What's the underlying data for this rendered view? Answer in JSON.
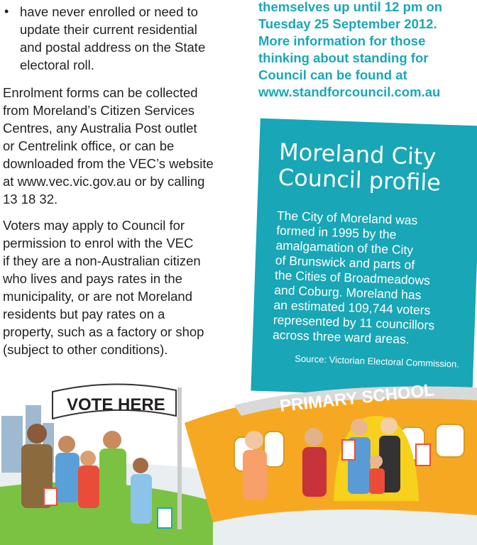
{
  "left": {
    "bullet_lines": [
      "have never enrolled or need to",
      "update their current residential",
      "and postal address on the State",
      "electoral roll."
    ],
    "para1_lines": [
      "Enrolment forms can be collected",
      "from Moreland’s Citizen Services",
      "Centres, any Australia Post outlet",
      "or Centrelink office, or can be",
      "downloaded from the VEC’s website",
      "at www.vec.vic.gov.au or by calling",
      "13 18 32."
    ],
    "para2_lines": [
      "Voters may apply to Council for",
      "permission to enrol with the VEC",
      "if they are a non-Australian citizen",
      "who lives and pays rates in the",
      "municipality, or are not Moreland",
      "residents but pay rates on a",
      "property, such as a factory or shop",
      "(subject to other conditions)."
    ]
  },
  "right_top_lines": [
    "themselves up until 12 pm on",
    "Tuesday 25 September 2012.",
    "More information for those",
    "thinking about standing for",
    "Council can be found at",
    "www.standforcouncil.com.au"
  ],
  "profile": {
    "title_lines": [
      "Moreland City",
      "Council profile"
    ],
    "body_lines": [
      "The City of Moreland was",
      "formed in 1995 by the",
      "amalgamation of the City",
      "of Brunswick and parts of",
      "the Cities of Broadmeadows",
      "and Coburg. Moreland has",
      "an estimated 109,744 voters",
      "represented by 11 councillors",
      "across three ward areas."
    ],
    "source": "Source: Victorian Electoral Commission."
  },
  "illustration": {
    "sign_text": "VOTE HERE",
    "school_text": "PRIMARY SCHOOL"
  },
  "colors": {
    "teal": "#19a6b6",
    "orange": "#f7a823",
    "yellow": "#f6d21d",
    "green": "#7cc242"
  }
}
